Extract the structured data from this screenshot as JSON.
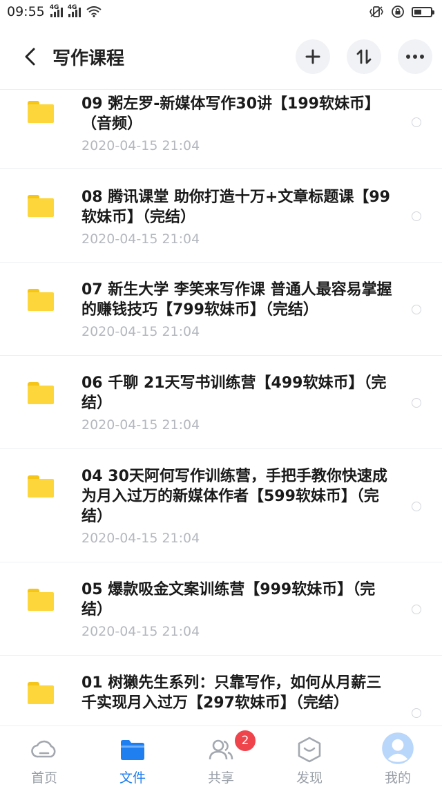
{
  "status_bar": {
    "time": "09:55",
    "signal1_label": "4G",
    "signal2_label": "4G",
    "battery_level": 0.45
  },
  "header": {
    "title": "写作课程",
    "add_label": "+",
    "sort_label": "⇅",
    "more_label": "•••"
  },
  "files": [
    {
      "name": "09 粥左罗-新媒体写作30讲【199软妹币】（音频）",
      "date": "2020-04-15  21:04"
    },
    {
      "name": "08 腾讯课堂 助你打造十万+文章标题课【99软妹币】（完结）",
      "date": "2020-04-15  21:04"
    },
    {
      "name": "07 新生大学 李笑来写作课 普通人最容易掌握的赚钱技巧【799软妹币】（完结）",
      "date": "2020-04-15  21:04"
    },
    {
      "name": "06 千聊 21天写书训练营【499软妹币】（完结）",
      "date": "2020-04-15  21:04"
    },
    {
      "name": "04 30天阿何写作训练营，手把手教你快速成为月入过万的新媒体作者【599软妹币】（完结）",
      "date": "2020-04-15  21:04"
    },
    {
      "name": "05 爆款吸金文案训练营【999软妹币】（完结）",
      "date": "2020-04-15  21:04"
    },
    {
      "name": "01 树獭先生系列：只靠写作，如何从月薪三千实现月入过万【297软妹币】（完结）",
      "date": ""
    }
  ],
  "bottom_nav": [
    {
      "label": "首页",
      "icon": "cloud-icon",
      "active": false
    },
    {
      "label": "文件",
      "icon": "folder-icon",
      "active": true
    },
    {
      "label": "共享",
      "icon": "people-icon",
      "active": false,
      "badge": "2"
    },
    {
      "label": "发现",
      "icon": "discover-icon",
      "active": false
    },
    {
      "label": "我的",
      "icon": "avatar-icon",
      "active": false
    }
  ],
  "colors": {
    "accent": "#1f7ef0",
    "folder": "#fcd63a",
    "badge": "#f0444c",
    "date_text": "#b4b8bf"
  }
}
